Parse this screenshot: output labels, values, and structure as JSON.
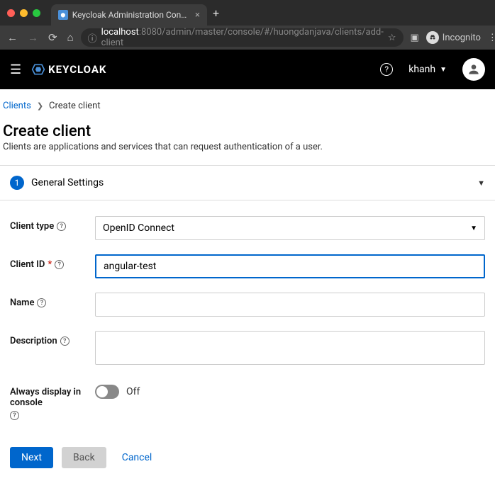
{
  "browser": {
    "tab_title": "Keycloak Administration Conso",
    "new_tab": "+",
    "url_host": "localhost",
    "url_port_path": ":8080/admin/master/console/#/huongdanjava/clients/add-client",
    "incognito_label": "Incognito"
  },
  "header": {
    "brand": "KEYCLOAK",
    "username": "khanh"
  },
  "breadcrumb": {
    "root": "Clients",
    "current": "Create client"
  },
  "page": {
    "title": "Create client",
    "description": "Clients are applications and services that can request authentication of a user."
  },
  "wizard": {
    "step_number": "1",
    "step_label": "General Settings"
  },
  "form": {
    "client_type_label": "Client type",
    "client_type_value": "OpenID Connect",
    "client_id_label": "Client ID",
    "client_id_value": "angular-test",
    "name_label": "Name",
    "name_value": "",
    "description_label": "Description",
    "description_value": "",
    "always_display_label": "Always display in console",
    "toggle_state": "Off"
  },
  "buttons": {
    "next": "Next",
    "back": "Back",
    "cancel": "Cancel"
  }
}
